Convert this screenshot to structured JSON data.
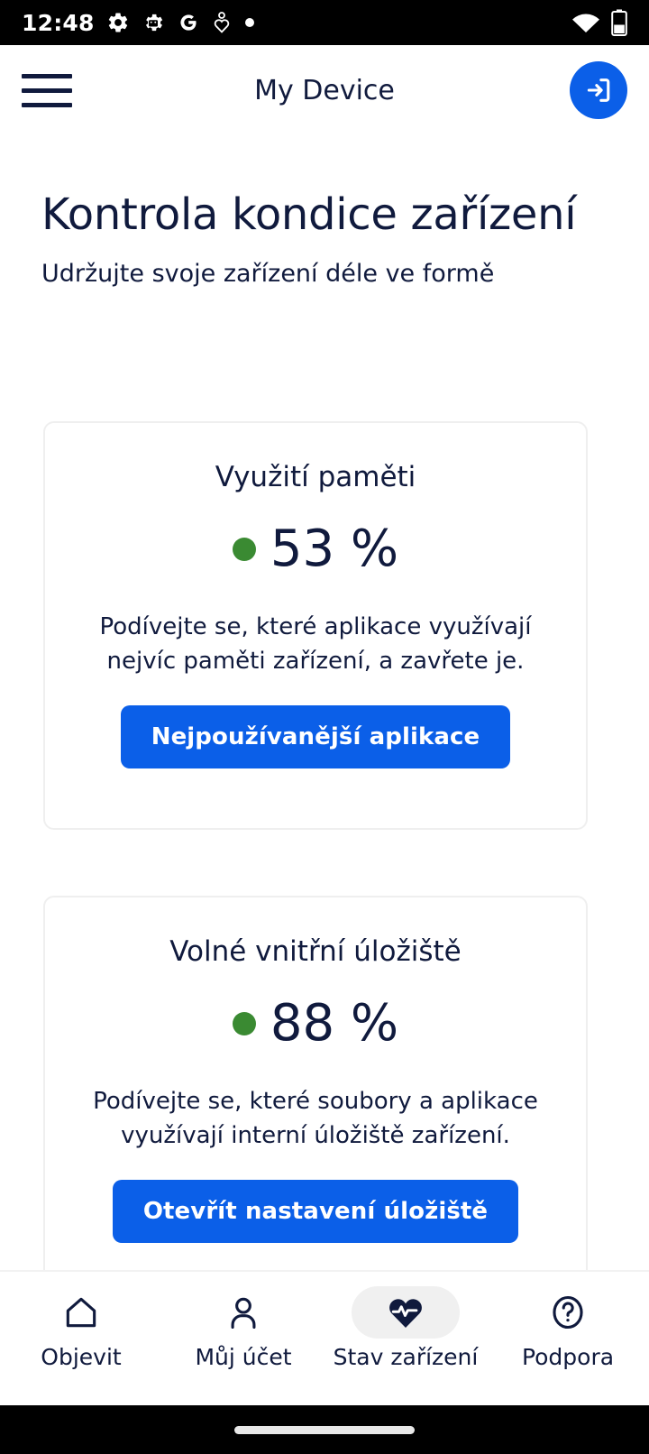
{
  "status_bar": {
    "time": "12:48",
    "left_icons": [
      "gear-icon",
      "android-settings-icon",
      "google-g-icon",
      "heart-health-icon",
      "dot-icon"
    ],
    "right_icons": [
      "wifi-icon",
      "battery-icon"
    ],
    "battery_level_pct": 40
  },
  "app_bar": {
    "menu_icon": "hamburger-menu-icon",
    "title": "My Device",
    "login_icon": "login-arrow-icon",
    "accent_color": "#0B5FE8"
  },
  "page": {
    "title": "Kontrola kondice zařízení",
    "subtitle": "Udržujte svoje zařízení déle ve formě",
    "text_color": "#101a3d"
  },
  "cards": [
    {
      "id": "memory",
      "title": "Využití paměti",
      "status_dot_color": "#3a8a32",
      "value": "53 %",
      "description": "Podívejte se, které aplikace využívají nejvíc paměti zařízení, a zavřete je.",
      "button_label": "Nejpoužívanější aplikace"
    },
    {
      "id": "storage",
      "title": "Volné vnitřní úložiště",
      "status_dot_color": "#3a8a32",
      "value": "88 %",
      "description": "Podívejte se, které soubory a aplikace využívají interní úložiště zařízení.",
      "button_label": "Otevřít nastavení úložiště"
    }
  ],
  "bottom_nav": {
    "active_index": 2,
    "items": [
      {
        "label": "Objevit",
        "icon": "home-icon"
      },
      {
        "label": "Můj účet",
        "icon": "person-icon"
      },
      {
        "label": "Stav zařízení",
        "icon": "heart-pulse-icon"
      },
      {
        "label": "Podpora",
        "icon": "question-circle-icon"
      }
    ]
  }
}
